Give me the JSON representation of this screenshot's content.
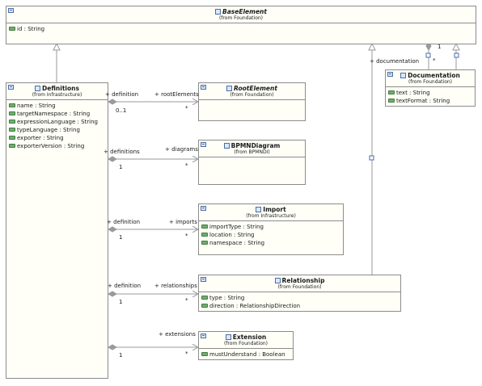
{
  "classes": {
    "base_element": {
      "name": "BaseElement",
      "pkg": "(from Foundation)",
      "attrs": [
        "id : String"
      ]
    },
    "definitions": {
      "name": "Definitions",
      "pkg": "(from Infrastructure)",
      "attrs": [
        "name : String",
        "targetNamespace : String",
        "expressionLanguage : String",
        "typeLanguage : String",
        "exporter : String",
        "exporterVersion : String"
      ]
    },
    "root_element": {
      "name": "RootElement",
      "pkg": "(from Foundation)"
    },
    "bpmn_diagram": {
      "name": "BPMNDiagram",
      "pkg": "(from BPMNDI)"
    },
    "import": {
      "name": "Import",
      "pkg": "(from Infrastructure)",
      "attrs": [
        "importType : String",
        "location : String",
        "namespace : String"
      ]
    },
    "relationship": {
      "name": "Relationship",
      "pkg": "(from Foundation)",
      "attrs": [
        "type : String",
        "direction : RelationshipDirection"
      ]
    },
    "extension": {
      "name": "Extension",
      "pkg": "(from Foundation)",
      "attrs": [
        "mustUnderstand : Boolean"
      ]
    },
    "documentation": {
      "name": "Documentation",
      "pkg": "(from Foundation)",
      "attrs": [
        "text : String",
        "textFormat : String"
      ]
    }
  },
  "labels": {
    "root_src": "+ definition",
    "root_tgt": "+ rootElements",
    "root_mult": "0..1",
    "root_tmult": "*",
    "diag_src": "+ definitions",
    "diag_tgt": "+ diagrams",
    "diag_mult": "1",
    "diag_tmult": "*",
    "imp_src": "+ definition",
    "imp_tgt": "+ imports",
    "imp_mult": "1",
    "imp_tmult": "*",
    "rel_src": "+ definition",
    "rel_tgt": "+ relationships",
    "rel_mult": "1",
    "rel_tmult": "*",
    "ext_tgt": "+ extensions",
    "ext_mult": "1",
    "ext_tmult": "*",
    "doc_role": "+ documentation",
    "doc_mult_one": "1",
    "doc_mult_many": "*"
  },
  "colors": {
    "line": "#9a9a9a",
    "class_fill": "#fffff8",
    "border": "#8c8c8c",
    "attr_icon": "#6fae6f"
  }
}
